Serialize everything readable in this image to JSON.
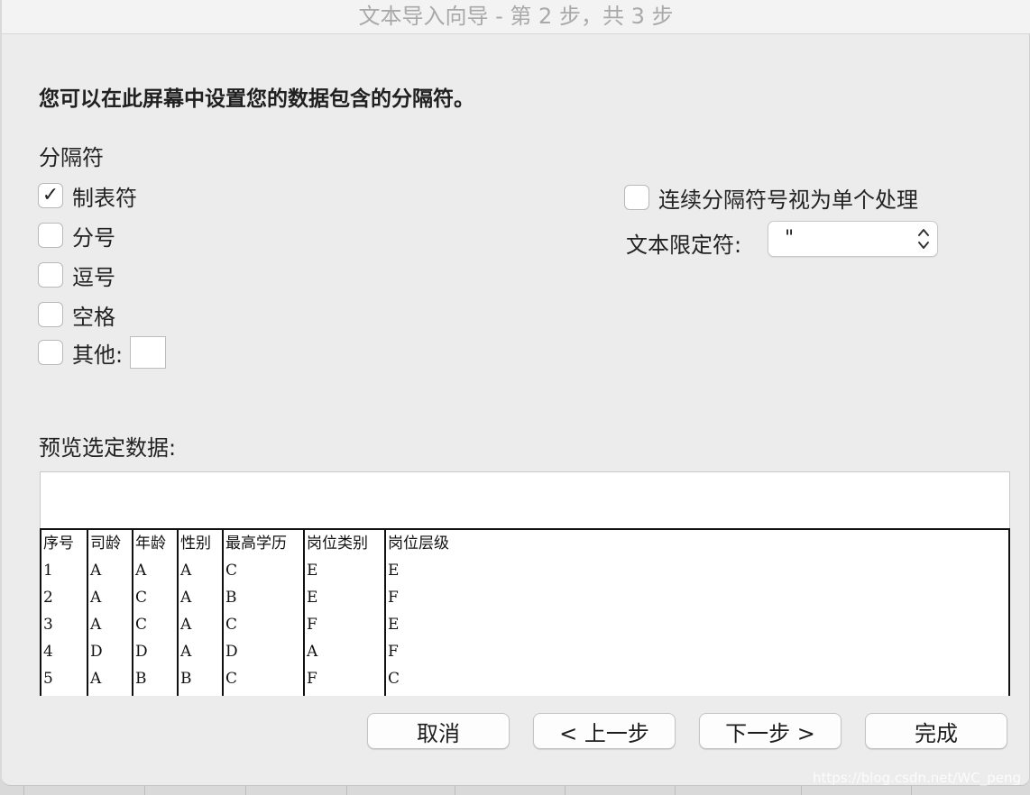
{
  "window": {
    "title": "文本导入向导 - 第 2 步，共 3 步"
  },
  "instruction": "您可以在此屏幕中设置您的数据包含的分隔符。",
  "delimiters": {
    "group_label": "分隔符",
    "tab": {
      "label": "制表符",
      "checked": true
    },
    "semicolon": {
      "label": "分号",
      "checked": false
    },
    "comma": {
      "label": "逗号",
      "checked": false
    },
    "space": {
      "label": "空格",
      "checked": false
    },
    "other": {
      "label": "其他:",
      "checked": false,
      "value": ""
    }
  },
  "consecutive": {
    "label": "连续分隔符号视为单个处理",
    "checked": false
  },
  "qualifier": {
    "label": "文本限定符:",
    "value": "\""
  },
  "preview": {
    "label": "预览选定数据:",
    "columns": [
      {
        "cells": [
          "序号",
          "1",
          "2",
          "3",
          "4",
          "5"
        ]
      },
      {
        "cells": [
          "司龄",
          "A",
          "A",
          "A",
          "D",
          "A"
        ]
      },
      {
        "cells": [
          "年龄",
          "A",
          "C",
          "C",
          "D",
          "B"
        ]
      },
      {
        "cells": [
          "性别",
          "A",
          "A",
          "A",
          "A",
          "B"
        ]
      },
      {
        "cells": [
          "最高学历",
          "C",
          "B",
          "C",
          "D",
          "C"
        ]
      },
      {
        "cells": [
          "岗位类别",
          "E",
          "E",
          "F",
          "A",
          "F"
        ]
      },
      {
        "cells": [
          "岗位层级",
          "E",
          "F",
          "E",
          "F",
          "C"
        ]
      }
    ]
  },
  "buttons": {
    "cancel": "取消",
    "back": "< 上一步",
    "next": "下一步 >",
    "finish": "完成"
  },
  "watermark": "https://blog.csdn.net/WC_peng",
  "colors": {
    "window_bg": "#ececec",
    "title_text": "#a9a9a9",
    "grid_border": "#111111"
  }
}
